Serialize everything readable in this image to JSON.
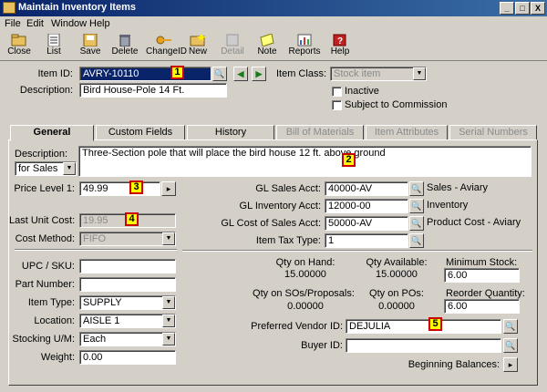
{
  "window": {
    "title": "Maintain Inventory Items",
    "min": "_",
    "max": "□",
    "close": "X"
  },
  "menu": [
    "File",
    "Edit",
    "Window",
    "Help"
  ],
  "toolbar": [
    {
      "label": "Close",
      "icon": "close-folder-icon",
      "enabled": true
    },
    {
      "label": "List",
      "icon": "list-icon",
      "enabled": true
    },
    {
      "label": "Save",
      "icon": "save-icon",
      "enabled": true
    },
    {
      "label": "Delete",
      "icon": "delete-icon",
      "enabled": true
    },
    {
      "label": "ChangeID",
      "icon": "key-icon",
      "enabled": true
    },
    {
      "label": "New",
      "icon": "new-icon",
      "enabled": true
    },
    {
      "label": "Detail",
      "icon": "detail-icon",
      "enabled": false
    },
    {
      "label": "Note",
      "icon": "note-icon",
      "enabled": true
    },
    {
      "label": "Reports",
      "icon": "reports-icon",
      "enabled": true
    },
    {
      "label": "Help",
      "icon": "help-book-icon",
      "enabled": true
    }
  ],
  "header": {
    "item_id_label": "Item ID:",
    "item_id": "AVRY-10110",
    "description_label": "Description:",
    "description": "Bird House-Pole 14 Ft.",
    "item_class_label": "Item Class:",
    "item_class": "Stock item",
    "inactive_label": "Inactive",
    "commission_label": "Subject to Commission"
  },
  "tabs": [
    "General",
    "Custom Fields",
    "History",
    "Bill of Materials",
    "Item Attributes",
    "Serial Numbers"
  ],
  "general": {
    "description_label": "Description:",
    "description_for": "for Sales",
    "long_description": "Three-Section pole that will place the bird house 12 ft. above ground",
    "price_level_label": "Price Level 1:",
    "price_level": "49.99",
    "last_unit_cost_label": "Last Unit Cost:",
    "last_unit_cost": "19.95",
    "cost_method_label": "Cost Method:",
    "cost_method": "FIFO",
    "gl_sales_label": "GL Sales Acct:",
    "gl_sales": "40000-AV",
    "gl_sales_desc": "Sales - Aviary",
    "gl_inventory_label": "GL Inventory Acct:",
    "gl_inventory": "12000-00",
    "gl_inventory_desc": "Inventory",
    "gl_cost_label": "GL Cost of Sales Acct:",
    "gl_cost": "50000-AV",
    "gl_cost_desc": "Product Cost - Aviary",
    "tax_type_label": "Item Tax Type:",
    "tax_type": "1",
    "upc_label": "UPC / SKU:",
    "upc": "",
    "part_number_label": "Part Number:",
    "part_number": "",
    "item_type_label": "Item Type:",
    "item_type": "SUPPLY",
    "location_label": "Location:",
    "location": "AISLE 1",
    "stocking_um_label": "Stocking U/M:",
    "stocking_um": "Each",
    "weight_label": "Weight:",
    "weight": "0.00",
    "qty_on_hand_label": "Qty on Hand:",
    "qty_on_hand": "15.00000",
    "qty_available_label": "Qty Available:",
    "qty_available": "15.00000",
    "min_stock_label": "Minimum Stock:",
    "min_stock": "6.00",
    "qty_so_label": "Qty on SOs/Proposals:",
    "qty_so": "0.00000",
    "qty_po_label": "Qty on POs:",
    "qty_po": "0.00000",
    "reorder_label": "Reorder Quantity:",
    "reorder": "6.00",
    "vendor_label": "Preferred Vendor ID:",
    "vendor": "DEJULIA",
    "buyer_label": "Buyer ID:",
    "buyer": "",
    "beginning_balances_label": "Beginning Balances:"
  },
  "callouts": [
    "1",
    "2",
    "3",
    "4",
    "5"
  ],
  "colors": {
    "titlebar": "#0a246a",
    "callout_fill": "#ffff00",
    "callout_border": "#cc0000"
  }
}
